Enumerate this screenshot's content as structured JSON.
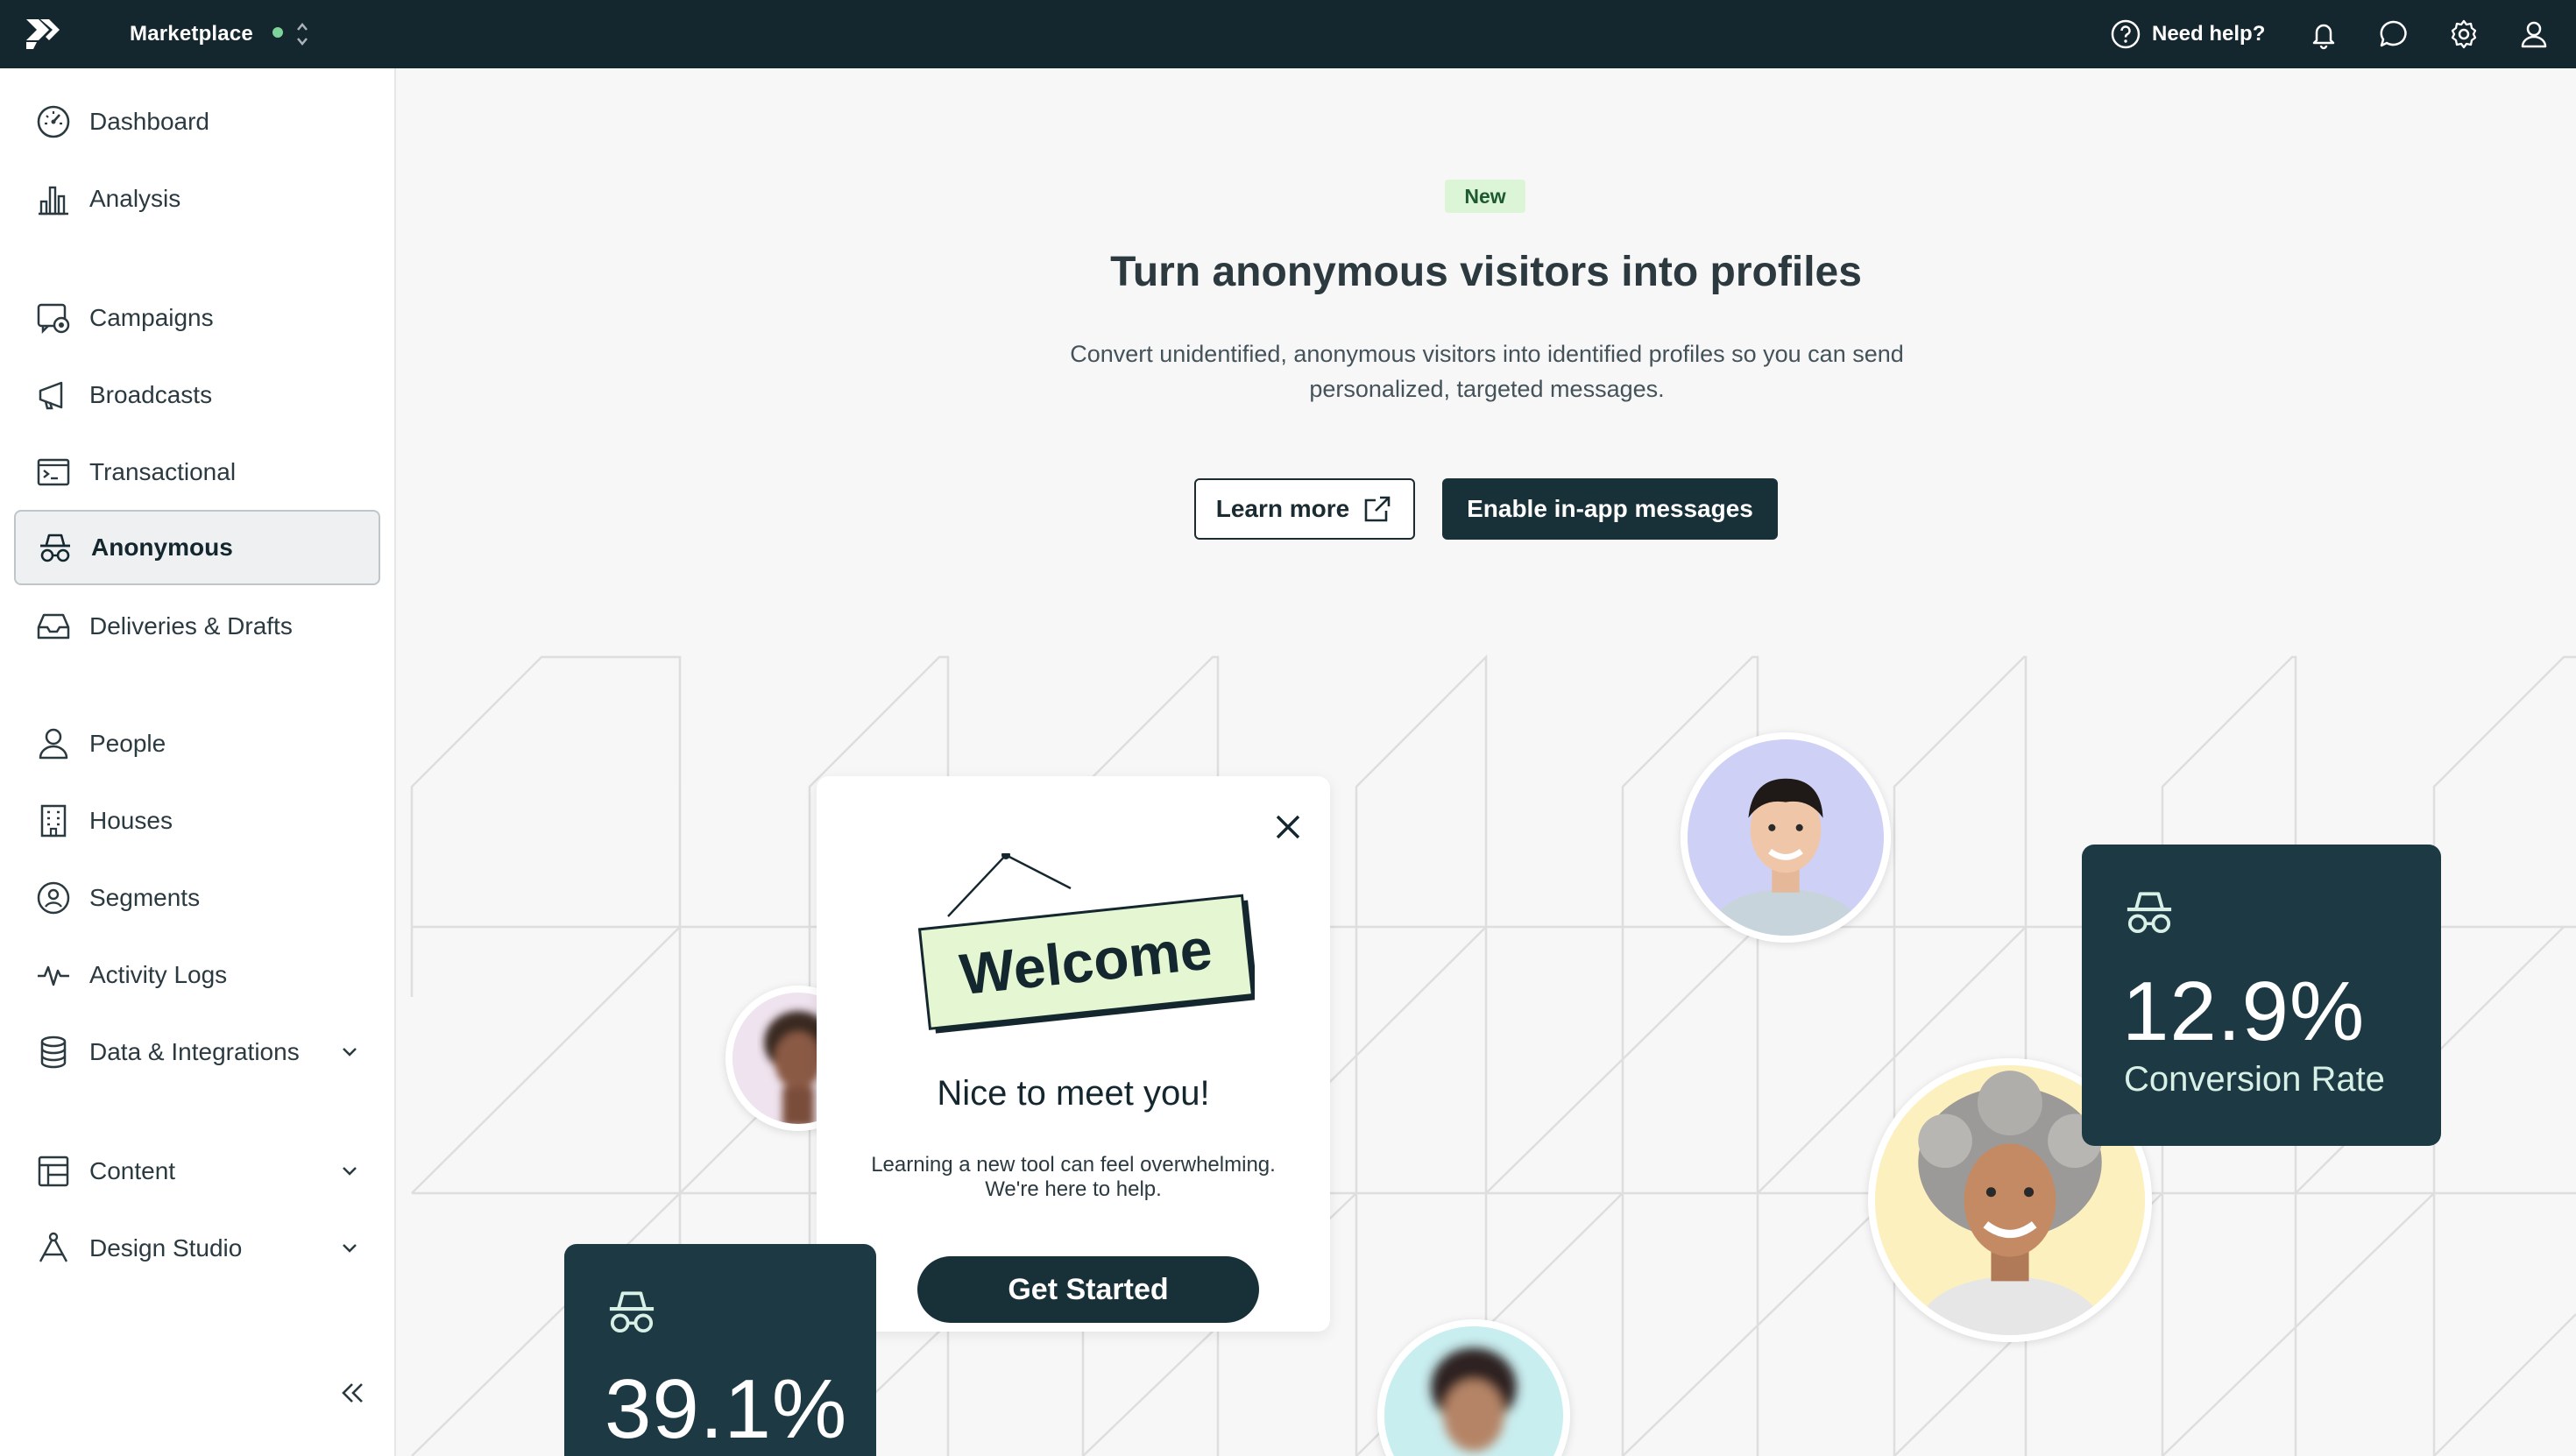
{
  "topbar": {
    "workspace": "Marketplace",
    "status_color": "#7ed39a",
    "help_label": "Need help?",
    "icons": [
      "question-circle-icon",
      "bell-icon",
      "chat-bubble-icon",
      "gear-icon",
      "user-icon"
    ]
  },
  "sidebar": {
    "items": [
      {
        "label": "Dashboard",
        "icon": "gauge-icon"
      },
      {
        "label": "Analysis",
        "icon": "bar-chart-icon"
      },
      {
        "label": "Campaigns",
        "icon": "campaign-icon"
      },
      {
        "label": "Broadcasts",
        "icon": "megaphone-icon"
      },
      {
        "label": "Transactional",
        "icon": "terminal-icon"
      },
      {
        "label": "Anonymous",
        "icon": "incognito-icon",
        "active": true
      },
      {
        "label": "Deliveries & Drafts",
        "icon": "inbox-icon"
      },
      {
        "label": "People",
        "icon": "person-icon"
      },
      {
        "label": "Houses",
        "icon": "building-icon"
      },
      {
        "label": "Segments",
        "icon": "segment-icon"
      },
      {
        "label": "Activity Logs",
        "icon": "pulse-icon"
      },
      {
        "label": "Data & Integrations",
        "icon": "database-icon",
        "expandable": true
      },
      {
        "label": "Content",
        "icon": "layout-icon",
        "expandable": true
      },
      {
        "label": "Design Studio",
        "icon": "pen-tool-icon",
        "expandable": true
      }
    ],
    "collapse_icon": "double-chevron-left-icon"
  },
  "main": {
    "badge": "New",
    "title": "Turn anonymous visitors into profiles",
    "subtitle": "Convert unidentified, anonymous visitors into identified profiles so you can send personalized, targeted messages.",
    "learn_more": "Learn more",
    "enable_button": "Enable in-app messages",
    "welcome_card": {
      "sign_text": "Welcome",
      "title": "Nice to meet you!",
      "text_line1": "Learning a new tool can feel overwhelming.",
      "text_line2": "We're here to help.",
      "button": "Get Started"
    },
    "stat_right": {
      "value": "12.9%",
      "label": "Conversion Rate"
    },
    "stat_left": {
      "value": "39.1%"
    },
    "colors": {
      "dark": "#14262e",
      "card": "#1d3a44",
      "badge_bg": "#dcf5d6",
      "sign_bg": "#e4f7d2"
    }
  }
}
